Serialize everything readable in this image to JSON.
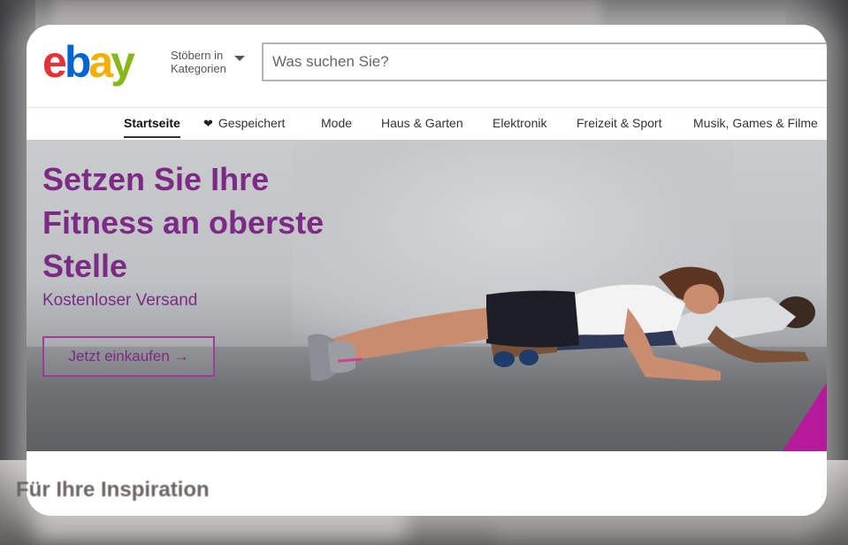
{
  "header": {
    "logo_letters": [
      "e",
      "b",
      "a",
      "y"
    ],
    "logo_colors": [
      "#e53238",
      "#0064d2",
      "#f5af02",
      "#86b817"
    ],
    "categories_line1": "Stöbern in",
    "categories_line2": "Kategorien",
    "search_placeholder": "Was suchen Sie?"
  },
  "nav": {
    "items": [
      {
        "label": "Startseite",
        "active": true
      },
      {
        "label": "Gespeichert",
        "icon": "heart-icon"
      },
      {
        "label": "Mode"
      },
      {
        "label": "Haus & Garten"
      },
      {
        "label": "Elektronik"
      },
      {
        "label": "Freizeit & Sport"
      },
      {
        "label": "Musik, Games & Filme"
      }
    ]
  },
  "hero": {
    "headline_line1": "Setzen Sie Ihre",
    "headline_line2": "Fitness an oberste",
    "headline_line3": "Stelle",
    "subline": "Kostenloser Versand",
    "cta_label": "Jetzt einkaufen →",
    "accent_color": "#7c2a86"
  },
  "section": {
    "title": "Für Ihre Inspiration"
  }
}
